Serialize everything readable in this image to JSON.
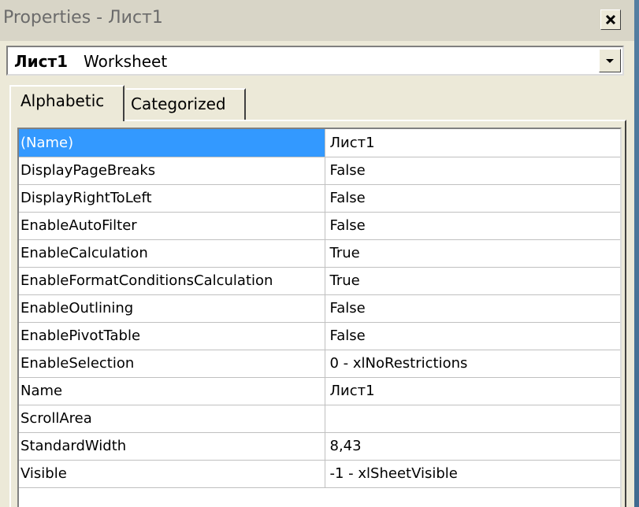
{
  "window": {
    "title": "Properties - Лист1"
  },
  "object_selector": {
    "name": "Лист1",
    "type": "Worksheet"
  },
  "tabs": [
    {
      "label": "Alphabetic",
      "active": true
    },
    {
      "label": "Categorized",
      "active": false
    }
  ],
  "properties": [
    {
      "name": "(Name)",
      "value": "Лист1",
      "selected": true
    },
    {
      "name": "DisplayPageBreaks",
      "value": "False"
    },
    {
      "name": "DisplayRightToLeft",
      "value": "False"
    },
    {
      "name": "EnableAutoFilter",
      "value": "False"
    },
    {
      "name": "EnableCalculation",
      "value": "True"
    },
    {
      "name": "EnableFormatConditionsCalculation",
      "value": "True"
    },
    {
      "name": "EnableOutlining",
      "value": "False"
    },
    {
      "name": "EnablePivotTable",
      "value": "False"
    },
    {
      "name": "EnableSelection",
      "value": "0 - xlNoRestrictions"
    },
    {
      "name": "Name",
      "value": "Лист1"
    },
    {
      "name": "ScrollArea",
      "value": ""
    },
    {
      "name": "StandardWidth",
      "value": "8,43"
    },
    {
      "name": "Visible",
      "value": "-1 - xlSheetVisible"
    }
  ],
  "icons": {
    "close": "close-icon",
    "dropdown": "chevron-down-icon"
  },
  "colors": {
    "selection": "#3399ff",
    "panel": "#ece9d8"
  }
}
